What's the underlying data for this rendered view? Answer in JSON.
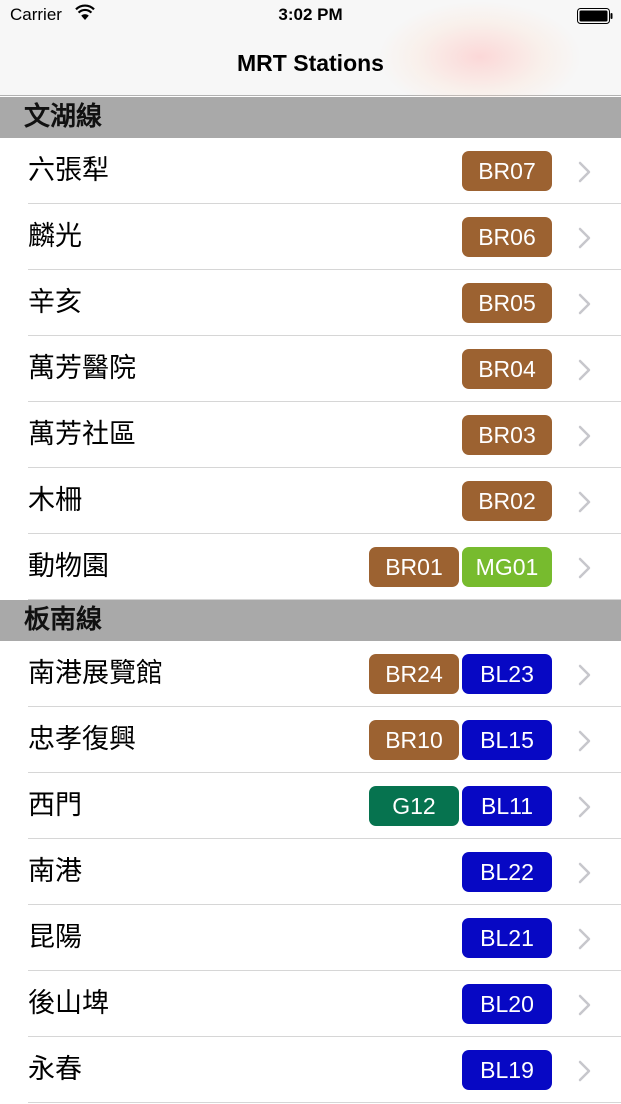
{
  "status_bar": {
    "carrier": "Carrier",
    "time": "3:02 PM"
  },
  "nav": {
    "title": "MRT Stations"
  },
  "colors": {
    "brown": "#9c6231",
    "light_green": "#77bb2e",
    "green": "#06734f",
    "blue": "#0708c4"
  },
  "sections": [
    {
      "title": "文湖線",
      "rows": [
        {
          "name": "六張犁",
          "codes": [
            {
              "code": "BR07",
              "color": "#9c6231"
            }
          ]
        },
        {
          "name": "麟光",
          "codes": [
            {
              "code": "BR06",
              "color": "#9c6231"
            }
          ]
        },
        {
          "name": "辛亥",
          "codes": [
            {
              "code": "BR05",
              "color": "#9c6231"
            }
          ]
        },
        {
          "name": "萬芳醫院",
          "codes": [
            {
              "code": "BR04",
              "color": "#9c6231"
            }
          ]
        },
        {
          "name": "萬芳社區",
          "codes": [
            {
              "code": "BR03",
              "color": "#9c6231"
            }
          ]
        },
        {
          "name": "木柵",
          "codes": [
            {
              "code": "BR02",
              "color": "#9c6231"
            }
          ]
        },
        {
          "name": "動物園",
          "codes": [
            {
              "code": "BR01",
              "color": "#9c6231"
            },
            {
              "code": "MG01",
              "color": "#77bb2e"
            }
          ]
        }
      ]
    },
    {
      "title": "板南線",
      "rows": [
        {
          "name": "南港展覽館",
          "codes": [
            {
              "code": "BR24",
              "color": "#9c6231"
            },
            {
              "code": "BL23",
              "color": "#0708c4"
            }
          ]
        },
        {
          "name": "忠孝復興",
          "codes": [
            {
              "code": "BR10",
              "color": "#9c6231"
            },
            {
              "code": "BL15",
              "color": "#0708c4"
            }
          ]
        },
        {
          "name": "西門",
          "codes": [
            {
              "code": "G12",
              "color": "#06734f"
            },
            {
              "code": "BL11",
              "color": "#0708c4"
            }
          ]
        },
        {
          "name": "南港",
          "codes": [
            {
              "code": "BL22",
              "color": "#0708c4"
            }
          ]
        },
        {
          "name": "昆陽",
          "codes": [
            {
              "code": "BL21",
              "color": "#0708c4"
            }
          ]
        },
        {
          "name": "後山埤",
          "codes": [
            {
              "code": "BL20",
              "color": "#0708c4"
            }
          ]
        },
        {
          "name": "永春",
          "codes": [
            {
              "code": "BL19",
              "color": "#0708c4"
            }
          ]
        }
      ]
    }
  ]
}
